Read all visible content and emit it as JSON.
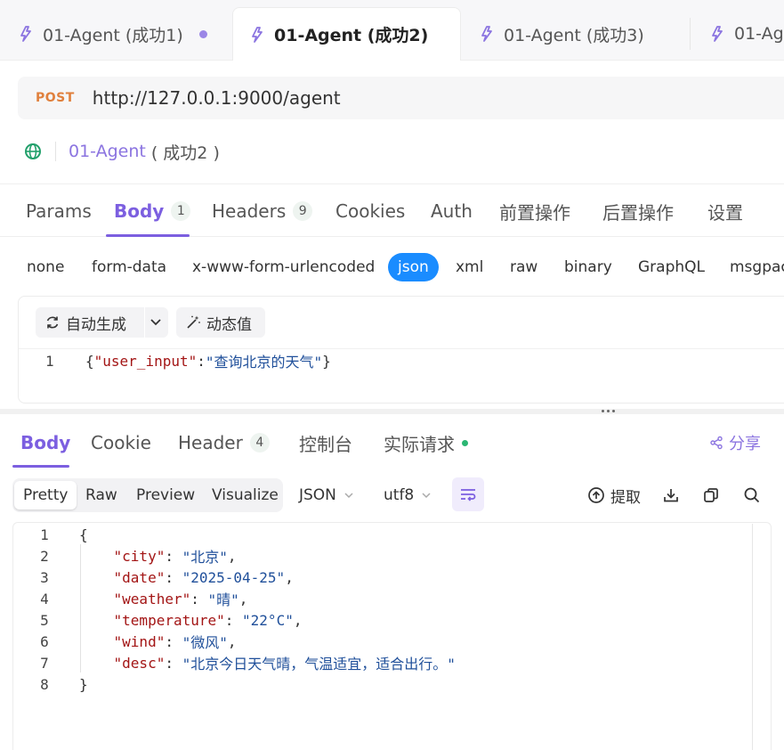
{
  "tabs": [
    {
      "label": "01-Agent (成功1)"
    },
    {
      "label": "01-Agent (成功2)"
    },
    {
      "label": "01-Agent (成功3)"
    },
    {
      "label": "01-Ag"
    }
  ],
  "request": {
    "method": "POST",
    "url": "http://127.0.0.1:9000/agent",
    "name": "01-Agent",
    "name_suffix": "( 成功2 )"
  },
  "request_tabs": [
    {
      "label": "Params"
    },
    {
      "label": "Body",
      "badge": "1"
    },
    {
      "label": "Headers",
      "badge": "9"
    },
    {
      "label": "Cookies"
    },
    {
      "label": "Auth"
    },
    {
      "label": "前置操作"
    },
    {
      "label": "后置操作"
    },
    {
      "label": "设置"
    }
  ],
  "body_types": [
    "none",
    "form-data",
    "x-www-form-urlencoded",
    "json",
    "xml",
    "raw",
    "binary",
    "GraphQL",
    "msgpac"
  ],
  "editor": {
    "auto_generate": "自动生成",
    "dynamic_value": "动态值",
    "line_number": "1",
    "code_open": "{",
    "code_key": "\"user_input\"",
    "code_colon": ":",
    "code_value": "\"查询北京的天气\"",
    "code_close": "}"
  },
  "response_tabs": [
    {
      "label": "Body"
    },
    {
      "label": "Cookie"
    },
    {
      "label": "Header",
      "badge": "4"
    },
    {
      "label": "控制台"
    },
    {
      "label": "实际请求"
    }
  ],
  "share_label": "分享",
  "view_modes": [
    "Pretty",
    "Raw",
    "Preview",
    "Visualize"
  ],
  "format_select": "JSON",
  "encoding_select": "utf8",
  "extract_label": "提取",
  "response_lines": [
    {
      "n": "1",
      "indent": "",
      "key": "",
      "value": "",
      "text": "{",
      "tail": ""
    },
    {
      "n": "2",
      "indent": "    ",
      "key": "\"city\"",
      "value": "\"北京\"",
      "text": "",
      "tail": ","
    },
    {
      "n": "3",
      "indent": "    ",
      "key": "\"date\"",
      "value": "\"2025-04-25\"",
      "text": "",
      "tail": ","
    },
    {
      "n": "4",
      "indent": "    ",
      "key": "\"weather\"",
      "value": "\"晴\"",
      "text": "",
      "tail": ","
    },
    {
      "n": "5",
      "indent": "    ",
      "key": "\"temperature\"",
      "value": "\"22°C\"",
      "text": "",
      "tail": ","
    },
    {
      "n": "6",
      "indent": "    ",
      "key": "\"wind\"",
      "value": "\"微风\"",
      "text": "",
      "tail": ","
    },
    {
      "n": "7",
      "indent": "    ",
      "key": "\"desc\"",
      "value": "\"北京今日天气晴，气温适宜，适合出行。\"",
      "text": "",
      "tail": ""
    },
    {
      "n": "8",
      "indent": "",
      "key": "",
      "value": "",
      "text": "}",
      "tail": ""
    }
  ]
}
